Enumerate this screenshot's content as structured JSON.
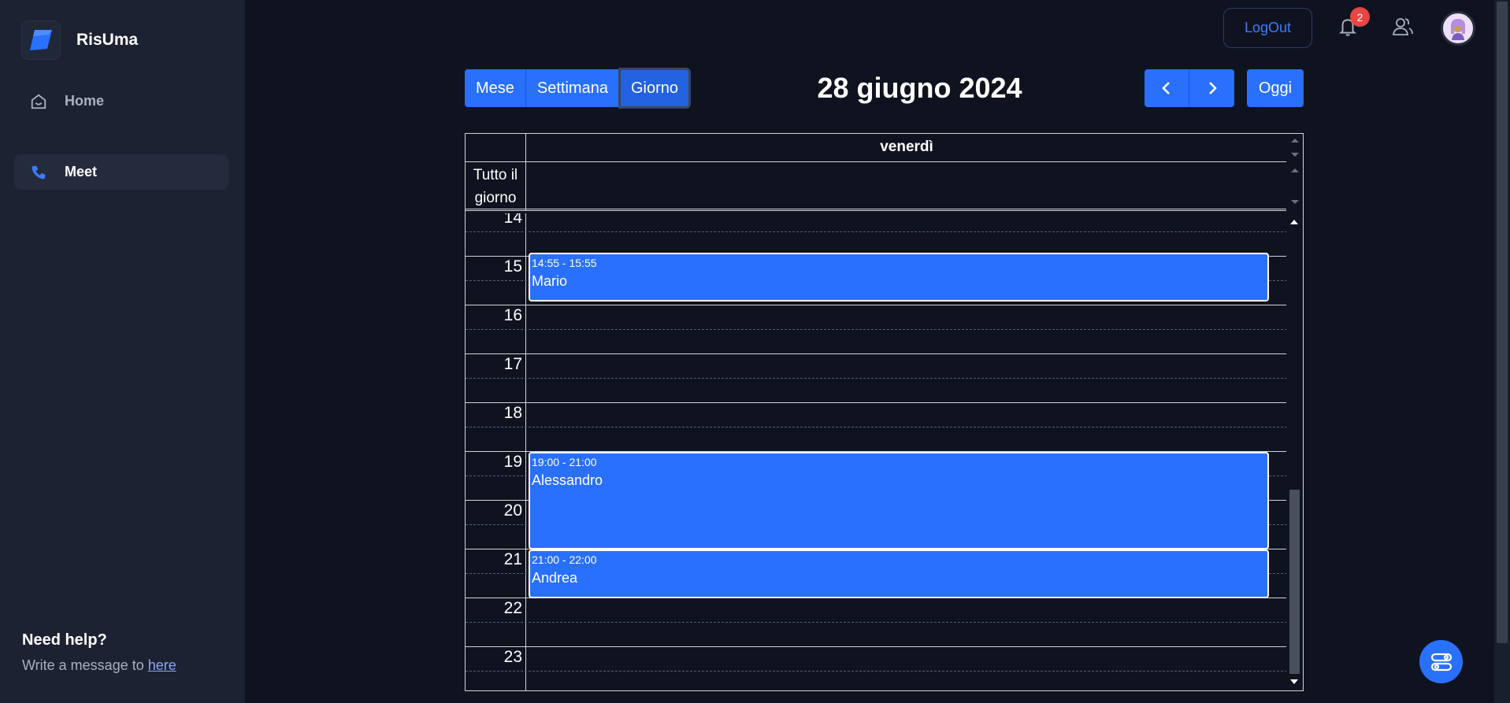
{
  "brand": {
    "name": "RisUma"
  },
  "sidebar": {
    "items": [
      {
        "label": "Home",
        "icon": "home-icon"
      },
      {
        "label": "Meet",
        "icon": "phone-icon"
      }
    ],
    "help": {
      "title": "Need help?",
      "text": "Write a message to ",
      "link": "here"
    }
  },
  "header": {
    "logout_label": "LogOut",
    "notification_count": "2"
  },
  "toolbar": {
    "views": [
      "Mese",
      "Settimana",
      "Giorno"
    ],
    "active_view": "Giorno",
    "title": "28 giugno 2024",
    "today_label": "Oggi"
  },
  "calendar": {
    "day_name": "venerdì",
    "allday_line1": "Tutto il",
    "allday_line2": "giorno",
    "hours": [
      "14",
      "15",
      "16",
      "17",
      "18",
      "19",
      "20",
      "21",
      "22",
      "23"
    ],
    "events": [
      {
        "time": "14:55 - 15:55",
        "title": "Mario"
      },
      {
        "time": "19:00 - 21:00",
        "title": "Alessandro"
      },
      {
        "time": "21:00 - 22:00",
        "title": "Andrea"
      }
    ]
  },
  "colors": {
    "accent": "#2970ff",
    "background": "#0f1320",
    "sidebar": "#1c2231",
    "badge": "#e84545"
  }
}
